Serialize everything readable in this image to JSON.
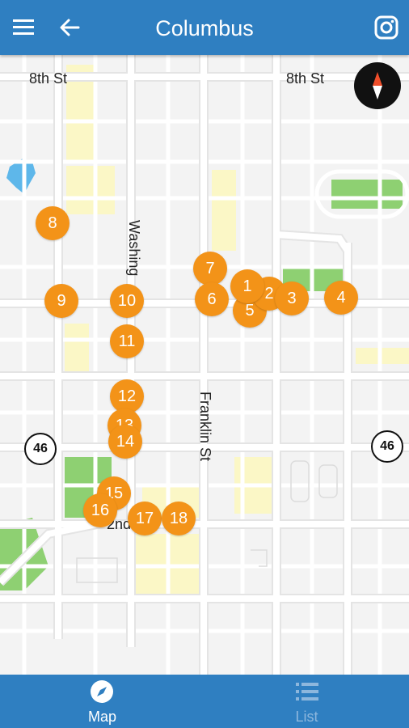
{
  "header": {
    "title": "Columbus",
    "menu_icon": "hamburger-menu-icon",
    "back_icon": "back-arrow-icon",
    "instagram_icon": "instagram-icon"
  },
  "map": {
    "street_labels": {
      "eighth_left": "8th St",
      "eighth_right": "8th St",
      "washington": "Washing",
      "franklin": "Franklin St",
      "second": "2nd"
    },
    "route_shields": {
      "left": "46",
      "right": "46"
    },
    "compass_icon": "compass-icon",
    "markers": [
      "1",
      "2",
      "3",
      "4",
      "5",
      "6",
      "7",
      "8",
      "9",
      "10",
      "11",
      "12",
      "13",
      "14",
      "15",
      "16",
      "17",
      "18"
    ],
    "colors": {
      "marker": "#f39318",
      "road": "#ffffff",
      "park": "#8ed072",
      "water": "#5eb7ea",
      "highlight": "#fbf7c6"
    }
  },
  "bottom_nav": {
    "map": {
      "label": "Map",
      "icon": "compass-icon",
      "active": true
    },
    "list": {
      "label": "List",
      "icon": "list-icon",
      "active": false
    }
  },
  "colors": {
    "brand": "#2f7fc1",
    "inactive_tab": "#8db7dd"
  }
}
